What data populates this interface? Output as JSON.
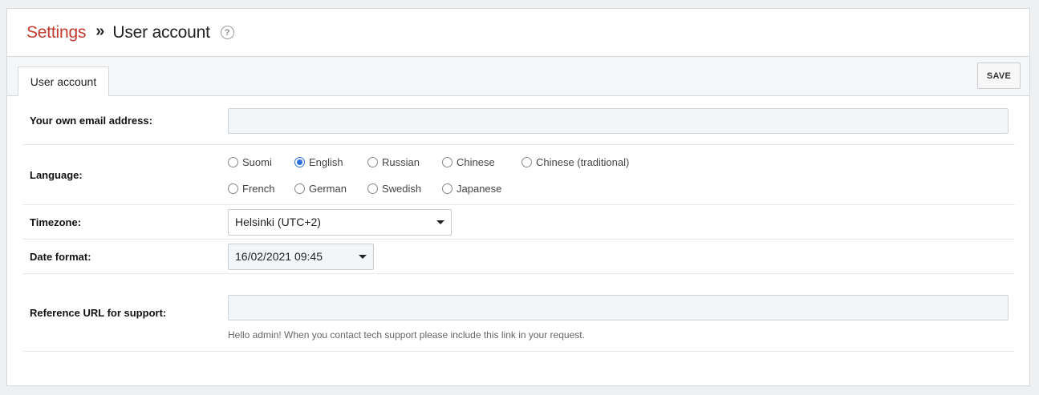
{
  "breadcrumb": {
    "root": "Settings",
    "separator": "»",
    "current": "User account",
    "help": "?"
  },
  "tabs": [
    {
      "label": "User account",
      "active": true
    }
  ],
  "toolbar": {
    "save_label": "SAVE"
  },
  "form": {
    "email": {
      "label": "Your own email address:",
      "value": ""
    },
    "language": {
      "label": "Language:",
      "options_row1": [
        "Suomi",
        "English",
        "Russian",
        "Chinese",
        "Chinese (traditional)"
      ],
      "options_row2": [
        "French",
        "German",
        "Swedish",
        "Japanese"
      ],
      "selected": "English"
    },
    "timezone": {
      "label": "Timezone:",
      "value": "Helsinki (UTC+2)"
    },
    "date_format": {
      "label": "Date format:",
      "value": "16/02/2021 09:45"
    },
    "reference_url": {
      "label": "Reference URL for support:",
      "value": "",
      "hint": "Hello admin! When you contact tech support please include this link in your request."
    }
  },
  "colors": {
    "accent": "#c23b2e",
    "radio_checked": "#2a6fdb"
  }
}
